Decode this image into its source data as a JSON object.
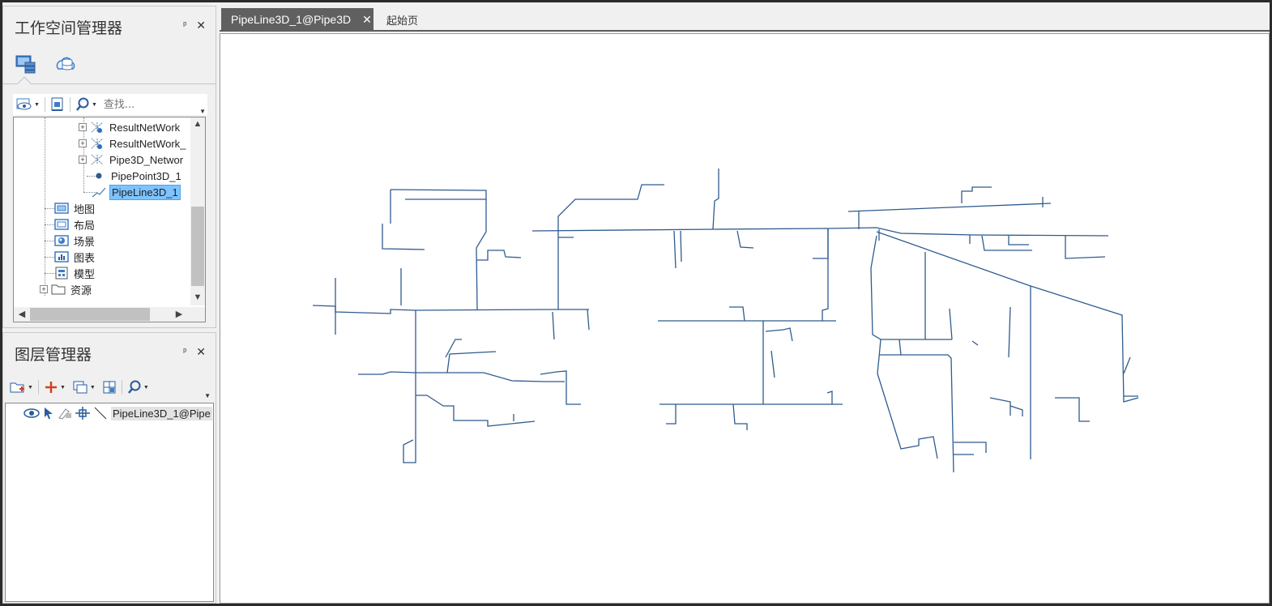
{
  "workspace_panel": {
    "title": "工作空间管理器",
    "pin": "ᵖ",
    "close": "✕",
    "search_placeholder": "查找...",
    "tree_items": [
      {
        "label": "ResultNetWork",
        "icon": "network-dataset-icon",
        "expandable": true
      },
      {
        "label": "ResultNetWork_",
        "icon": "network-dataset-icon",
        "expandable": true
      },
      {
        "label": "Pipe3D_Networ",
        "icon": "network-dataset-icon",
        "expandable": true
      },
      {
        "label": "PipePoint3D_1",
        "icon": "point-dataset-icon",
        "expandable": false
      },
      {
        "label": "PipeLine3D_1",
        "icon": "line-dataset-icon",
        "expandable": false,
        "selected": true
      },
      {
        "label": "地图",
        "icon": "map-folder-icon",
        "expandable": false
      },
      {
        "label": "布局",
        "icon": "layout-folder-icon",
        "expandable": false
      },
      {
        "label": "场景",
        "icon": "scene-folder-icon",
        "expandable": false
      },
      {
        "label": "图表",
        "icon": "chart-folder-icon",
        "expandable": false
      },
      {
        "label": "模型",
        "icon": "model-folder-icon",
        "expandable": false
      },
      {
        "label": "资源",
        "icon": "resource-folder-icon",
        "expandable": true
      }
    ]
  },
  "layer_panel": {
    "title": "图层管理器",
    "pin": "ᵖ",
    "close": "✕",
    "layers": [
      {
        "name": "PipeLine3D_1@Pipe"
      }
    ]
  },
  "tabs": [
    {
      "label": "PipeLine3D_1@Pipe3D",
      "active": true,
      "close": "✕"
    },
    {
      "label": "起始页",
      "active": false
    }
  ],
  "colors": {
    "pipe_line": "#2f5b8f",
    "selection": "#7ec3ff",
    "tab_active": "#606060"
  }
}
